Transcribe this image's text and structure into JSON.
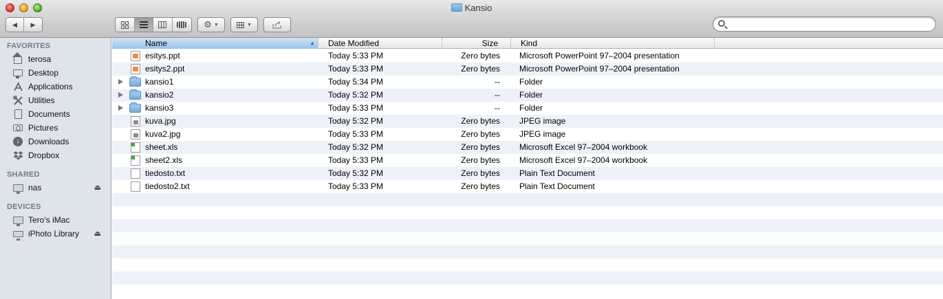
{
  "window": {
    "title": "Kansio"
  },
  "toolbar": {
    "nav_back": "◀",
    "nav_forward": "▶",
    "view_modes": [
      "icon",
      "list",
      "column",
      "coverflow"
    ],
    "active_view": "list",
    "search": {
      "value": "",
      "placeholder": ""
    }
  },
  "sidebar": {
    "favorites_header": "FAVORITES",
    "favorites": [
      {
        "label": "terosa",
        "icon": "house-icon"
      },
      {
        "label": "Desktop",
        "icon": "desktop-icon"
      },
      {
        "label": "Applications",
        "icon": "applications-icon"
      },
      {
        "label": "Utilities",
        "icon": "utilities-icon"
      },
      {
        "label": "Documents",
        "icon": "documents-icon"
      },
      {
        "label": "Pictures",
        "icon": "camera-icon"
      },
      {
        "label": "Downloads",
        "icon": "download-icon"
      },
      {
        "label": "Dropbox",
        "icon": "dropbox-icon"
      }
    ],
    "shared_header": "SHARED",
    "shared": [
      {
        "label": "nas",
        "icon": "monitor-icon",
        "eject": "⏏"
      }
    ],
    "devices_header": "DEVICES",
    "devices": [
      {
        "label": "Tero’s iMac",
        "icon": "monitor-icon"
      },
      {
        "label": "iPhoto Library",
        "icon": "drive-icon",
        "eject": "⏏"
      }
    ]
  },
  "columns": {
    "name": "Name",
    "date": "Date Modified",
    "size": "Size",
    "kind": "Kind",
    "sort_column": "name"
  },
  "files": [
    {
      "name": "esitys.ppt",
      "date": "Today 5:33 PM",
      "size": "Zero bytes",
      "kind": "Microsoft PowerPoint 97–2004 presentation",
      "type": "ppt",
      "folder": false
    },
    {
      "name": "esitys2.ppt",
      "date": "Today 5:33 PM",
      "size": "Zero bytes",
      "kind": "Microsoft PowerPoint 97–2004 presentation",
      "type": "ppt",
      "folder": false
    },
    {
      "name": "kansio1",
      "date": "Today 5:34 PM",
      "size": "--",
      "kind": "Folder",
      "type": "folder",
      "folder": true
    },
    {
      "name": "kansio2",
      "date": "Today 5:32 PM",
      "size": "--",
      "kind": "Folder",
      "type": "folder",
      "folder": true
    },
    {
      "name": "kansio3",
      "date": "Today 5:33 PM",
      "size": "--",
      "kind": "Folder",
      "type": "folder",
      "folder": true
    },
    {
      "name": "kuva.jpg",
      "date": "Today 5:32 PM",
      "size": "Zero bytes",
      "kind": "JPEG image",
      "type": "jpg",
      "folder": false
    },
    {
      "name": "kuva2.jpg",
      "date": "Today 5:33 PM",
      "size": "Zero bytes",
      "kind": "JPEG image",
      "type": "jpg",
      "folder": false
    },
    {
      "name": "sheet.xls",
      "date": "Today 5:32 PM",
      "size": "Zero bytes",
      "kind": "Microsoft Excel 97–2004 workbook",
      "type": "xls",
      "folder": false
    },
    {
      "name": "sheet2.xls",
      "date": "Today 5:33 PM",
      "size": "Zero bytes",
      "kind": "Microsoft Excel 97–2004 workbook",
      "type": "xls",
      "folder": false
    },
    {
      "name": "tiedosto.txt",
      "date": "Today 5:32 PM",
      "size": "Zero bytes",
      "kind": "Plain Text Document",
      "type": "txt",
      "folder": false
    },
    {
      "name": "tiedosto2.txt",
      "date": "Today 5:33 PM",
      "size": "Zero bytes",
      "kind": "Plain Text Document",
      "type": "txt",
      "folder": false
    }
  ]
}
